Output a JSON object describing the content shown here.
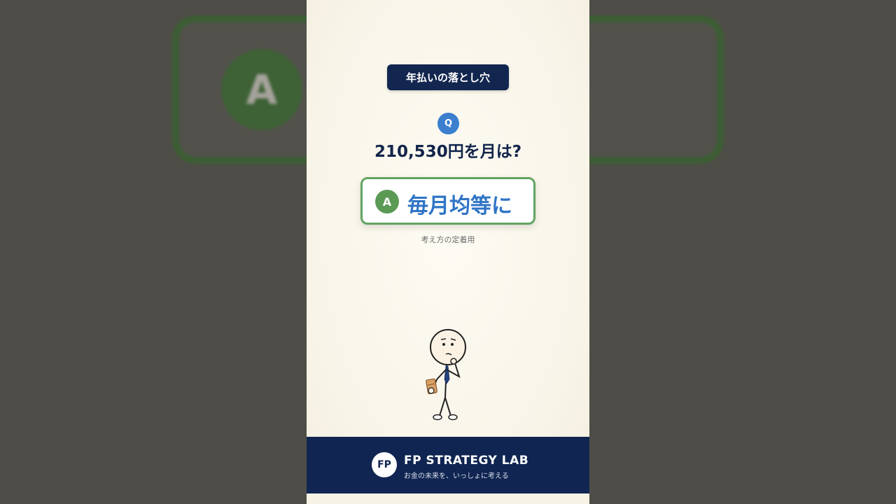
{
  "topic_label": "年払いの落とし穴",
  "question": {
    "badge": "Q",
    "text": "210,530円を月は?"
  },
  "answer": {
    "badge": "A",
    "text": "毎月均等に"
  },
  "caption": "考え方の定着用",
  "footer": {
    "logo_text": "FP",
    "brand_name": "FP STRATEGY LAB",
    "tagline": "お金の未来を、いっしょに考える"
  },
  "colors": {
    "navy": "#102551",
    "question_blue": "#3b7fce",
    "answer_green": "#62a460",
    "answer_text_blue": "#2f74c6",
    "card_bg": "#f8f4e8"
  },
  "icons": {
    "character": "thinking-stick-figure-holding-money"
  }
}
